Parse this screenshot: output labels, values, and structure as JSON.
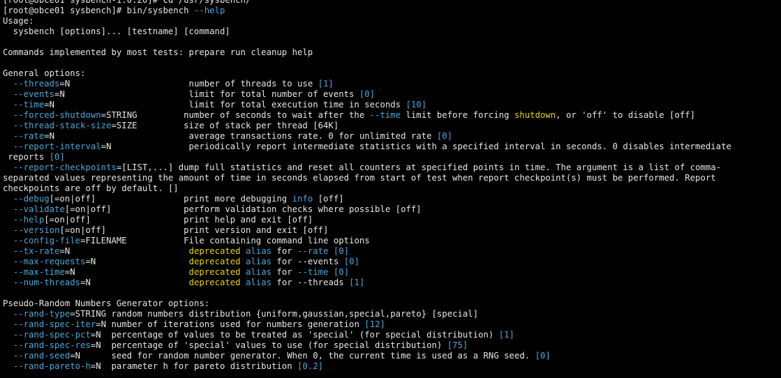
{
  "terminal": {
    "lines": [
      [
        [
          "n",
          "[root@obce01 sysbench-1.0.20]# cd /usr/sysbench/"
        ]
      ],
      [
        [
          "n",
          "[root@obce01 sysbench]# bin/sysbench "
        ],
        [
          "c",
          "--help"
        ]
      ],
      [
        [
          "n",
          "Usage:"
        ]
      ],
      [
        [
          "n",
          "  sysbench [options]... [testname] [command]"
        ]
      ],
      [
        [
          "n",
          ""
        ]
      ],
      [
        [
          "n",
          "Commands implemented by most tests: prepare run cleanup help"
        ]
      ],
      [
        [
          "n",
          ""
        ]
      ],
      [
        [
          "n",
          "General options:"
        ]
      ],
      [
        [
          "n",
          "  "
        ],
        [
          "c",
          "--threads"
        ],
        [
          "n",
          "=N                       number of threads to use "
        ],
        [
          "c",
          "[1]"
        ]
      ],
      [
        [
          "n",
          "  "
        ],
        [
          "c",
          "--events"
        ],
        [
          "n",
          "=N                        limit for total number of events "
        ],
        [
          "c",
          "[0]"
        ]
      ],
      [
        [
          "n",
          "  "
        ],
        [
          "c",
          "--time"
        ],
        [
          "n",
          "=N                          limit for total execution time in seconds "
        ],
        [
          "c",
          "[10]"
        ]
      ],
      [
        [
          "n",
          "  "
        ],
        [
          "c",
          "--forced-shutdown"
        ],
        [
          "n",
          "=STRING         number of seconds to wait after the "
        ],
        [
          "c",
          "--time"
        ],
        [
          "n",
          " limit before forcing "
        ],
        [
          "y",
          "shutdown"
        ],
        [
          "n",
          ", or 'off' to disable [off]"
        ]
      ],
      [
        [
          "n",
          "  "
        ],
        [
          "c",
          "--thread-stack-size"
        ],
        [
          "n",
          "=SIZE         size of stack per thread [64K]"
        ]
      ],
      [
        [
          "n",
          "  "
        ],
        [
          "c",
          "--rate"
        ],
        [
          "n",
          "=N                          average transactions rate. 0 for unlimited rate "
        ],
        [
          "c",
          "[0]"
        ]
      ],
      [
        [
          "n",
          "  "
        ],
        [
          "c",
          "--report-interval"
        ],
        [
          "n",
          "=N               periodically report intermediate statistics with a specified interval in seconds. 0 disables intermediate"
        ]
      ],
      [
        [
          "n",
          " reports "
        ],
        [
          "c",
          "[0]"
        ]
      ],
      [
        [
          "n",
          "  "
        ],
        [
          "c",
          "--report-checkpoints"
        ],
        [
          "n",
          "=[LIST,...] dump full statistics and reset all counters at specified points in time. The argument is a list of comma-"
        ]
      ],
      [
        [
          "n",
          "separated values representing the amount of time in seconds elapsed from start of test when report checkpoint(s) must be performed. Report"
        ]
      ],
      [
        [
          "n",
          "checkpoints are off by default. []"
        ]
      ],
      [
        [
          "n",
          "  "
        ],
        [
          "c",
          "--debug"
        ],
        [
          "n",
          "[=on|off]                 print more debugging "
        ],
        [
          "c",
          "info"
        ],
        [
          "n",
          " [off]"
        ]
      ],
      [
        [
          "n",
          "  "
        ],
        [
          "c",
          "--validate"
        ],
        [
          "n",
          "[=on|off]              perform validation checks where possible [off]"
        ]
      ],
      [
        [
          "n",
          "  "
        ],
        [
          "c",
          "--help"
        ],
        [
          "n",
          "[=on|off]                  print help and exit [off]"
        ]
      ],
      [
        [
          "n",
          "  "
        ],
        [
          "c",
          "--version"
        ],
        [
          "n",
          "[=on|off]               print version and exit [off]"
        ]
      ],
      [
        [
          "n",
          "  "
        ],
        [
          "c",
          "--config-file"
        ],
        [
          "n",
          "=FILENAME           File containing command line options"
        ]
      ],
      [
        [
          "n",
          "  "
        ],
        [
          "c",
          "--tx-rate"
        ],
        [
          "n",
          "=N                       "
        ],
        [
          "y",
          "deprecated"
        ],
        [
          "n",
          " "
        ],
        [
          "c",
          "alias"
        ],
        [
          "n",
          " for "
        ],
        [
          "c",
          "--rate"
        ],
        [
          "n",
          " "
        ],
        [
          "c",
          "[0]"
        ]
      ],
      [
        [
          "n",
          "  "
        ],
        [
          "c",
          "--max-requests"
        ],
        [
          "n",
          "=N                  "
        ],
        [
          "y",
          "deprecated"
        ],
        [
          "n",
          " "
        ],
        [
          "c",
          "alias"
        ],
        [
          "n",
          " for --events "
        ],
        [
          "c",
          "[0]"
        ]
      ],
      [
        [
          "n",
          "  "
        ],
        [
          "c",
          "--max-time"
        ],
        [
          "n",
          "=N                      "
        ],
        [
          "y",
          "deprecated"
        ],
        [
          "n",
          " "
        ],
        [
          "c",
          "alias"
        ],
        [
          "n",
          " for "
        ],
        [
          "c",
          "--time"
        ],
        [
          "n",
          " "
        ],
        [
          "c",
          "[0]"
        ]
      ],
      [
        [
          "n",
          "  "
        ],
        [
          "c",
          "--num-threads"
        ],
        [
          "n",
          "=N                   "
        ],
        [
          "y",
          "deprecated"
        ],
        [
          "n",
          " "
        ],
        [
          "c",
          "alias"
        ],
        [
          "n",
          " for --threads "
        ],
        [
          "c",
          "[1]"
        ]
      ],
      [
        [
          "n",
          ""
        ]
      ],
      [
        [
          "n",
          "Pseudo-Random Numbers Generator options:"
        ]
      ],
      [
        [
          "n",
          "  "
        ],
        [
          "c",
          "--rand-type"
        ],
        [
          "n",
          "=STRING random numbers distribution {uniform,gaussian,special,pareto} [special]"
        ]
      ],
      [
        [
          "n",
          "  "
        ],
        [
          "c",
          "--rand-spec-iter"
        ],
        [
          "n",
          "=N number of iterations used for numbers generation "
        ],
        [
          "c",
          "[12]"
        ]
      ],
      [
        [
          "n",
          "  "
        ],
        [
          "c",
          "--rand-spec-pct"
        ],
        [
          "n",
          "=N  percentage of values to be treated as 'special' (for special distribution) "
        ],
        [
          "c",
          "[1]"
        ]
      ],
      [
        [
          "n",
          "  "
        ],
        [
          "c",
          "--rand-spec-res"
        ],
        [
          "n",
          "=N  percentage of 'special' values to use (for special distribution) "
        ],
        [
          "c",
          "[75]"
        ]
      ],
      [
        [
          "n",
          "  "
        ],
        [
          "c",
          "--rand-seed"
        ],
        [
          "n",
          "=N      seed for random number generator. When 0, the current time is used as a RNG seed. "
        ],
        [
          "c",
          "[0]"
        ]
      ],
      [
        [
          "n",
          "  "
        ],
        [
          "c",
          "--rand-pareto-h"
        ],
        [
          "n",
          "=N  parameter h for pareto distribution "
        ],
        [
          "c",
          "[0.2]"
        ]
      ]
    ]
  },
  "colors": {
    "background": "#000000",
    "text": "#e6e6e6",
    "option": "#4aa7d8",
    "keyword": "#e8d000"
  }
}
